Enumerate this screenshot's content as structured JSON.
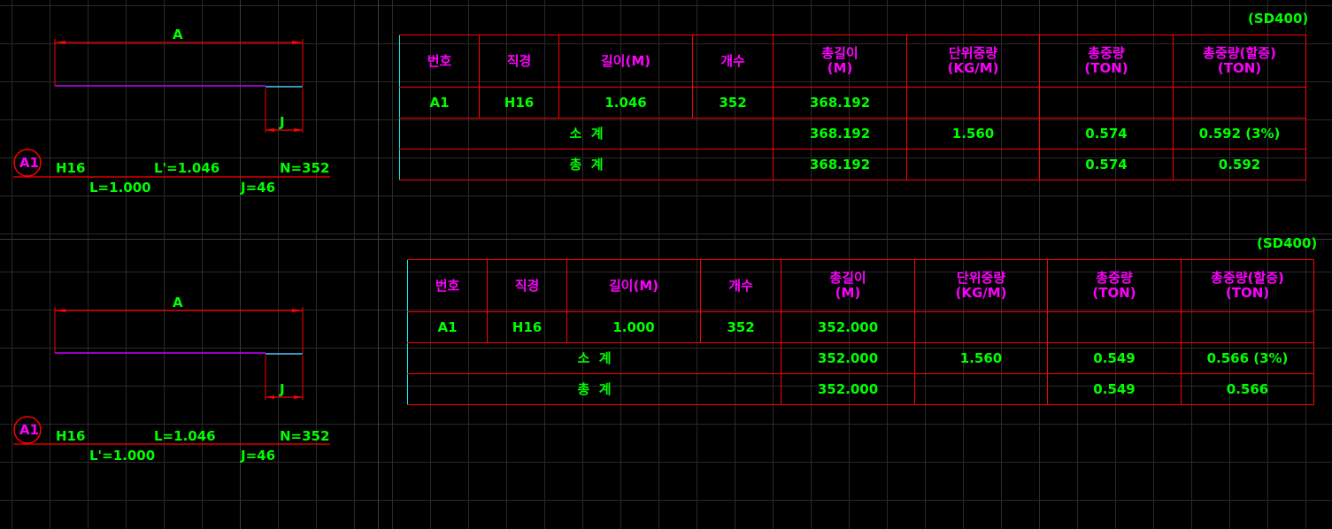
{
  "grade": "(SD400)",
  "columns": [
    "번호",
    "직경",
    "길이(M)",
    "개수",
    "총길이\n(M)",
    "단위중량\n(KG/M)",
    "총중량\n(TON)",
    "총중량(할증)\n(TON)"
  ],
  "tables": [
    {
      "grade": "(SD400)",
      "row": {
        "no": "A1",
        "dia": "H16",
        "len": "1.046",
        "count": "352",
        "total_len": "368.192"
      },
      "subtotal": {
        "label": "소  계",
        "total_len": "368.192",
        "unit_wt": "1.560",
        "total_wt": "0.574",
        "total_wt_extra": "0.592 (3%)"
      },
      "total": {
        "label": "총  계",
        "total_len": "368.192",
        "total_wt": "0.574",
        "total_wt_extra": "0.592"
      }
    },
    {
      "grade": "(SD400)",
      "row": {
        "no": "A1",
        "dia": "H16",
        "len": "1.000",
        "count": "352",
        "total_len": "352.000"
      },
      "subtotal": {
        "label": "소  계",
        "total_len": "352.000",
        "unit_wt": "1.560",
        "total_wt": "0.549",
        "total_wt_extra": "0.566 (3%)"
      },
      "total": {
        "label": "총  계",
        "total_len": "352.000",
        "total_wt": "0.549",
        "total_wt_extra": "0.566"
      }
    }
  ],
  "bars": [
    {
      "dim_a": "A",
      "dim_j": "J",
      "mark": "A1",
      "dia": "H16",
      "len_a": "L'=1.046",
      "count": "N=352",
      "len_b": "L=1.000",
      "j": "J=46"
    },
    {
      "dim_a": "A",
      "dim_j": "J",
      "mark": "A1",
      "dia": "H16",
      "len_a": "L=1.046",
      "count": "N=352",
      "len_b": "L'=1.000",
      "j": "J=46"
    }
  ],
  "colors": {
    "background": "#000000",
    "text_green": "#00ff00",
    "text_magenta": "#ff00ff",
    "dim_red": "#ff0000",
    "table_border": "#00ffff",
    "bar_line": "#cc00ff"
  }
}
